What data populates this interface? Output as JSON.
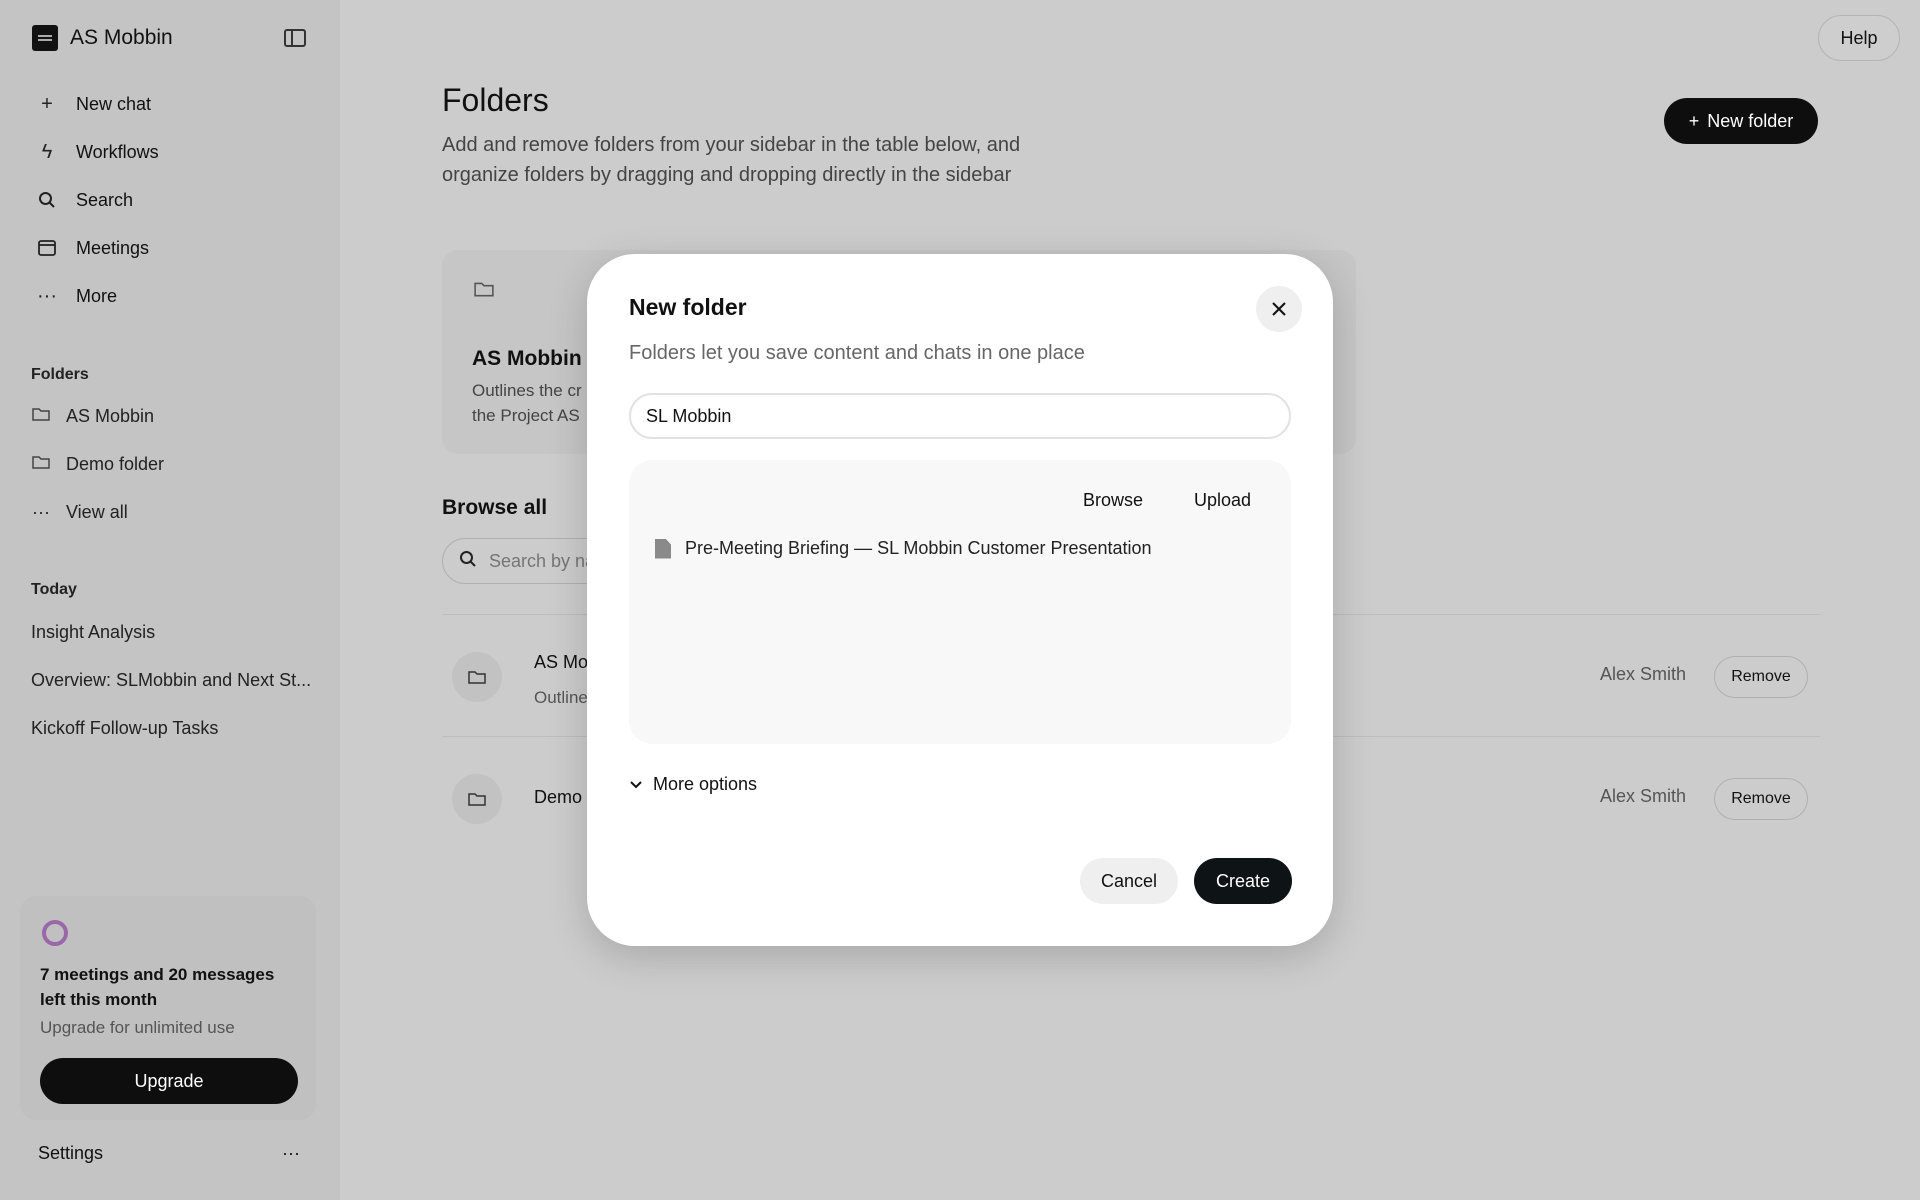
{
  "sidebar": {
    "workspace_name": "AS Mobbin",
    "nav": [
      {
        "label": "New chat",
        "icon": "plus-icon"
      },
      {
        "label": "Workflows",
        "icon": "bolt-icon"
      },
      {
        "label": "Search",
        "icon": "search-icon"
      },
      {
        "label": "Meetings",
        "icon": "calendar-icon"
      },
      {
        "label": "More",
        "icon": "ellipsis-icon"
      }
    ],
    "folders_label": "Folders",
    "folders": [
      {
        "label": "AS Mobbin"
      },
      {
        "label": "Demo folder"
      }
    ],
    "view_all": "View all",
    "today_label": "Today",
    "today": [
      {
        "label": "Insight Analysis"
      },
      {
        "label": "Overview: SLMobbin and Next St..."
      },
      {
        "label": "Kickoff Follow-up Tasks"
      }
    ],
    "upgrade": {
      "title": "7 meetings and 20 messages left this month",
      "subtitle": "Upgrade for unlimited use",
      "button": "Upgrade"
    },
    "settings": "Settings"
  },
  "header": {
    "help": "Help"
  },
  "main": {
    "title": "Folders",
    "description": "Add and remove folders from your sidebar in the table below, and organize folders by dragging and dropping directly in the sidebar",
    "new_folder_button": "New folder",
    "card": {
      "title": "AS Mobbin",
      "description_line1": "Outlines the cr",
      "description_line2": "the Project AS"
    },
    "browse_title": "Browse all",
    "search_placeholder": "Search by na",
    "rows": [
      {
        "title": "AS Mo",
        "subtitle": "Outline",
        "owner": "Alex Smith",
        "action": "Remove"
      },
      {
        "title": "Demo",
        "subtitle": "",
        "owner": "Alex Smith",
        "action": "Remove"
      }
    ]
  },
  "modal": {
    "title": "New folder",
    "subtitle": "Folders let you save content and chats in one place",
    "name_value": "SL Mobbin",
    "tabs": {
      "browse": "Browse",
      "upload": "Upload"
    },
    "file": "Pre-Meeting Briefing — SL Mobbin Customer Presentation",
    "more_options": "More options",
    "cancel": "Cancel",
    "create": "Create"
  }
}
